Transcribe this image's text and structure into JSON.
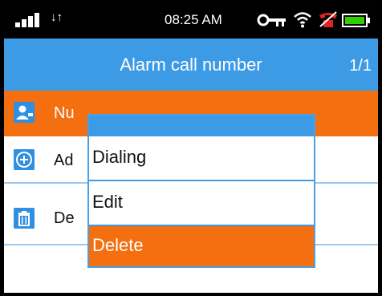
{
  "status_bar": {
    "time": "08:25 AM",
    "data_arrows": "↓↑",
    "icons": [
      "signal-icon",
      "key-icon",
      "wifi-icon",
      "alarm-icon",
      "battery-icon"
    ],
    "battery_color": "#2fd000"
  },
  "header": {
    "title": "Alarm call number",
    "page_indicator": "1/1"
  },
  "list": {
    "items": [
      {
        "label": "Nu",
        "icon": "contact-icon",
        "selected": true
      },
      {
        "label": "Ad",
        "icon": "add-icon",
        "selected": false
      },
      {
        "label": "De",
        "icon": "trash-icon",
        "selected": false
      }
    ]
  },
  "context_menu": {
    "options": [
      {
        "label": "Dialing"
      },
      {
        "label": "Edit"
      },
      {
        "label": "Delete",
        "highlighted": true
      }
    ]
  },
  "colors": {
    "accent_blue": "#3d9be6",
    "highlight_orange": "#f36f10",
    "divider_blue": "#9cc8ee"
  }
}
